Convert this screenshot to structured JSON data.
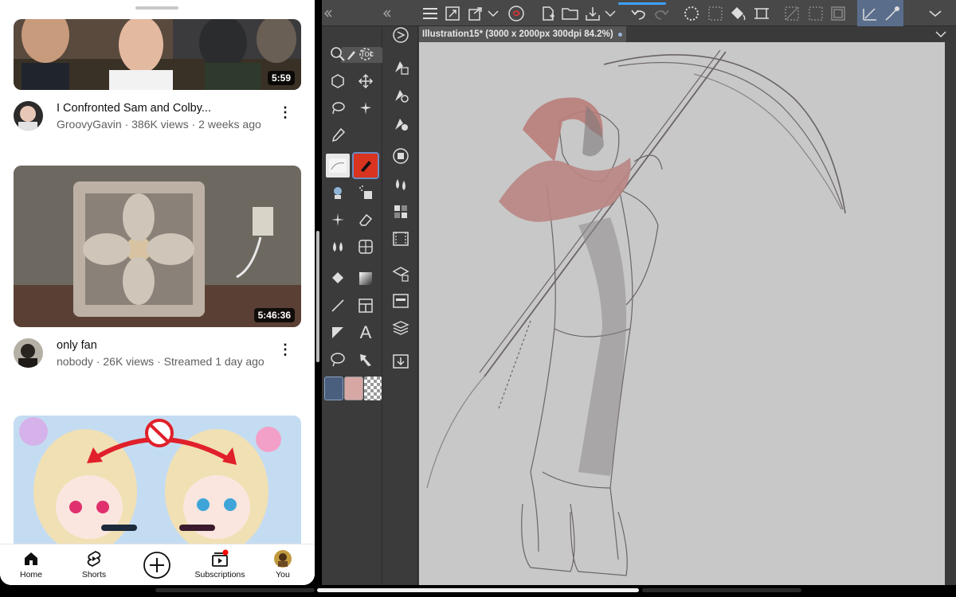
{
  "youtube": {
    "videos": [
      {
        "title": "I Confronted Sam and Colby...",
        "meta": "GroovyGavin · 386K views · 2 weeks ago",
        "duration": "5:59"
      },
      {
        "title": "only fan",
        "meta": "nobody · 26K views · Streamed 1 day ago",
        "duration": "5:46:36"
      },
      {
        "title": "",
        "meta": "",
        "duration": ""
      }
    ],
    "nav": {
      "home": "Home",
      "shorts": "Shorts",
      "subscriptions": "Subscriptions",
      "you": "You"
    }
  },
  "clip_studio": {
    "tool_tab_label": "Toc",
    "document_tab": "Illustration15* (3000 x 2000px 300dpi 84.2%)",
    "colors": {
      "main": "#4a5f7e",
      "sub": "#d7a7a4",
      "accent": "#3ea2ff"
    }
  }
}
